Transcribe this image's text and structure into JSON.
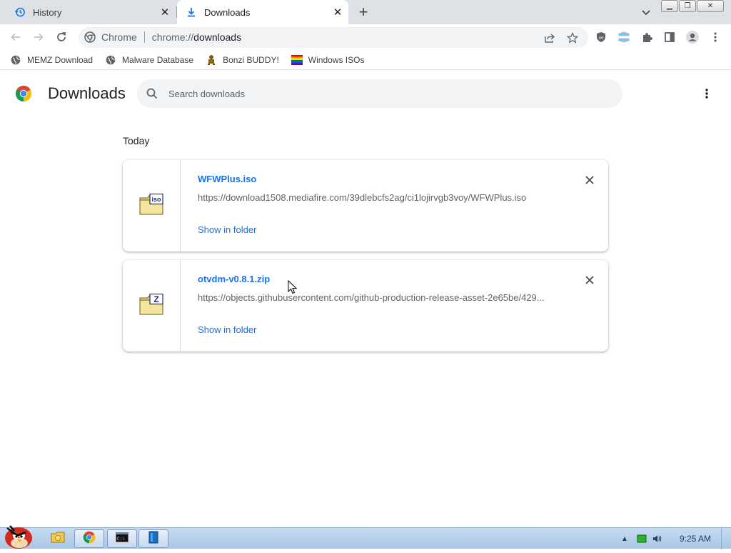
{
  "tabs": [
    {
      "label": "History",
      "icon": "history-icon"
    },
    {
      "label": "Downloads",
      "icon": "download-icon"
    }
  ],
  "omnibox": {
    "site": "Chrome",
    "url_prefix": "chrome://",
    "url_host": "downloads"
  },
  "bookmarks": [
    {
      "label": "MEMZ Download",
      "icon": "globe-icon"
    },
    {
      "label": "Malware Database",
      "icon": "globe-icon"
    },
    {
      "label": "Bonzi BUDDY!",
      "icon": "bonzi-icon"
    },
    {
      "label": "Windows ISOs",
      "icon": "windows-flag-icon"
    }
  ],
  "page": {
    "title": "Downloads",
    "search_placeholder": "Search downloads",
    "date_label": "Today"
  },
  "downloads": [
    {
      "filename": "WFWPlus.iso",
      "url": "https://download1508.mediafire.com/39dlebcfs2ag/ci1lojirvgb3voy/WFWPlus.iso",
      "action": "Show in folder",
      "file_badge": "iso"
    },
    {
      "filename": "otvdm-v0.8.1.zip",
      "url": "https://objects.githubusercontent.com/github-production-release-asset-2e65be/429...",
      "action": "Show in folder",
      "file_badge": "Z"
    }
  ],
  "taskbar": {
    "clock": "9:25 AM"
  },
  "colors": {
    "link": "#1a73e8",
    "tab_strip": "#dee1e6",
    "taskbar": "#b9d1ee"
  }
}
